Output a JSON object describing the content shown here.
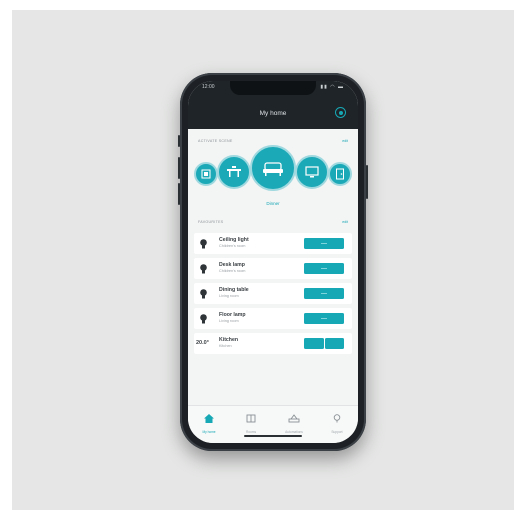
{
  "status_bar": {
    "time": "12:00",
    "indicators": "▮▮ ◠ ▬"
  },
  "header": {
    "title": "My home",
    "user_icon": "user-circle-icon"
  },
  "scenes_section": {
    "title": "ACTIVATE SCENE",
    "link": "edit",
    "active_scene_label": "Dinner",
    "icons": [
      "picture-frame-icon",
      "dining-table-icon",
      "sofa-icon",
      "tv-icon",
      "door-icon"
    ]
  },
  "favourites_section": {
    "title": "FAVOURITES",
    "link": "edit"
  },
  "devices": [
    {
      "name": "Ceiling light",
      "room": "Children's room",
      "icon": "bulb-icon"
    },
    {
      "name": "Desk lamp",
      "room": "Children's room",
      "icon": "bulb-icon"
    },
    {
      "name": "Dining table",
      "room": "Living room",
      "icon": "bulb-icon"
    },
    {
      "name": "Floor lamp",
      "room": "Living room",
      "icon": "bulb-icon"
    },
    {
      "name": "Kitchen",
      "room": "Kitchen",
      "temperature": "20.0°"
    }
  ],
  "tabs": [
    {
      "label": "My home",
      "icon": "home-icon",
      "active": true
    },
    {
      "label": "Rooms",
      "icon": "rooms-icon",
      "active": false
    },
    {
      "label": "Automations",
      "icon": "automation-icon",
      "active": false
    },
    {
      "label": "Support",
      "icon": "support-icon",
      "active": false
    }
  ],
  "colors": {
    "accent": "#17a8b5",
    "header": "#1e2428",
    "background": "#e5e6e5"
  }
}
